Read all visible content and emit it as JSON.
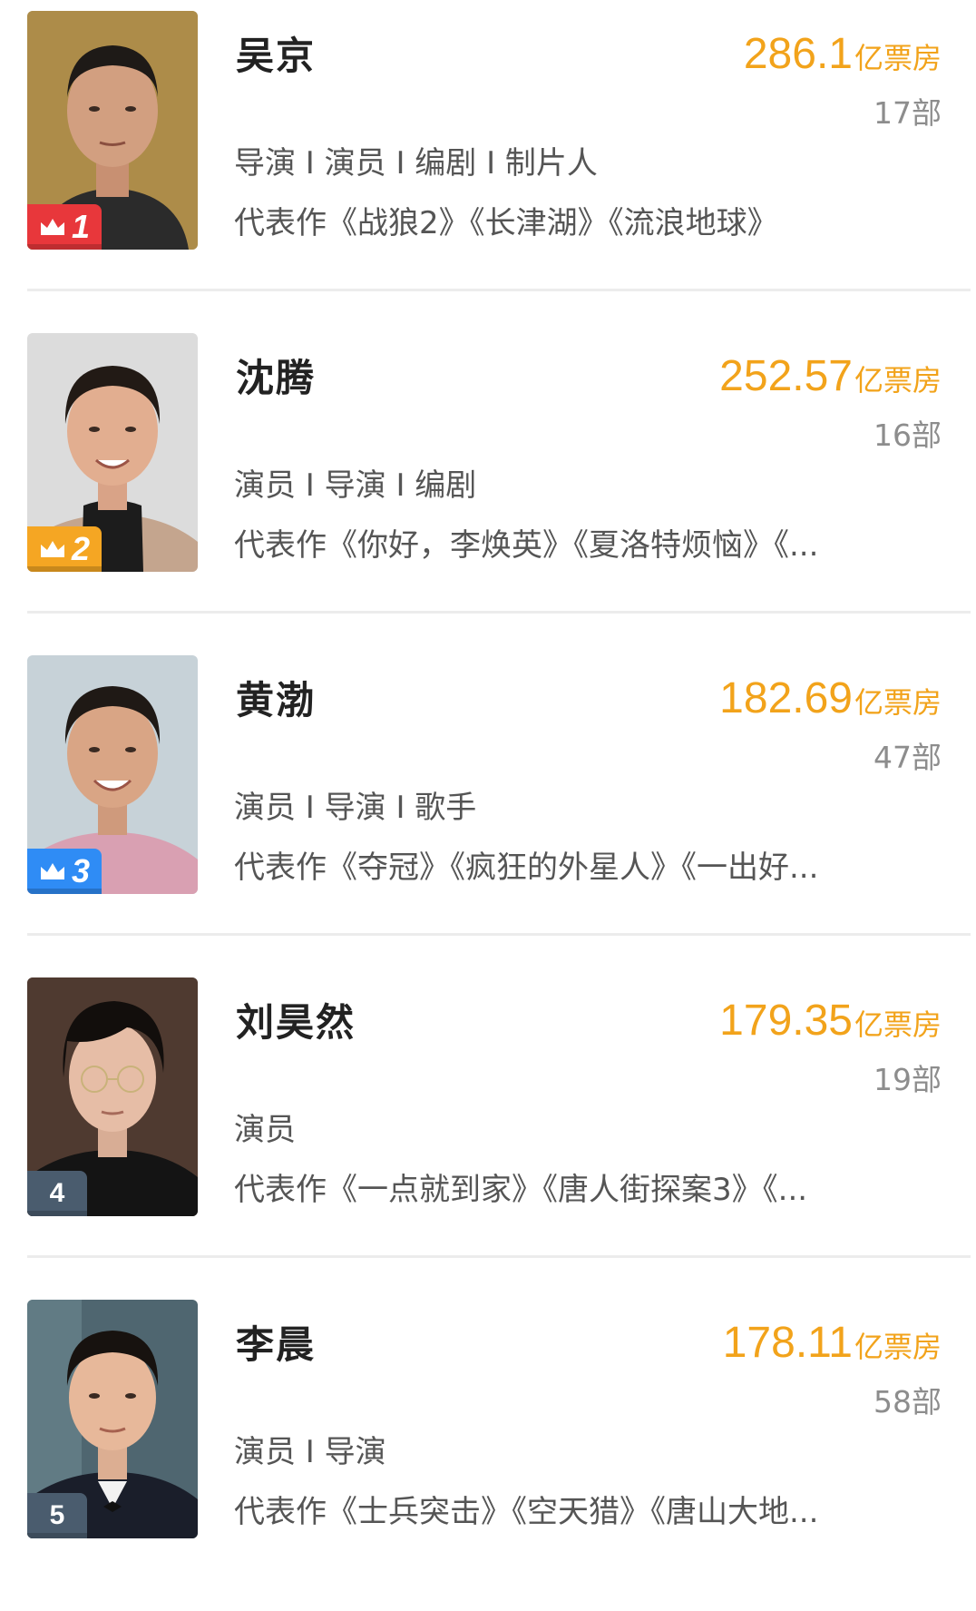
{
  "colors": {
    "boxoffice": "#f2a31b",
    "rank_1": "#e8373b",
    "rank_2": "#f5a623",
    "rank_3": "#2f8cf5",
    "rank_other": "#4a5c6e",
    "divider": "#ececec"
  },
  "rankings": [
    {
      "rank": "1",
      "name": "吴京",
      "boxoffice_value": "286.1",
      "boxoffice_unit": "亿票房",
      "film_count": "17部",
      "roles": "导演 I 演员 I 编剧 I 制片人",
      "works": "代表作《战狼2》《长津湖》《流浪地球》",
      "badge_icon": "crown-icon"
    },
    {
      "rank": "2",
      "name": "沈腾",
      "boxoffice_value": "252.57",
      "boxoffice_unit": "亿票房",
      "film_count": "16部",
      "roles": "演员 I 导演 I 编剧",
      "works": "代表作《你好，李焕英》《夏洛特烦恼》《...",
      "badge_icon": "crown-icon"
    },
    {
      "rank": "3",
      "name": "黄渤",
      "boxoffice_value": "182.69",
      "boxoffice_unit": "亿票房",
      "film_count": "47部",
      "roles": "演员 I 导演 I 歌手",
      "works": "代表作《夺冠》《疯狂的外星人》《一出好...",
      "badge_icon": "crown-icon"
    },
    {
      "rank": "4",
      "name": "刘昊然",
      "boxoffice_value": "179.35",
      "boxoffice_unit": "亿票房",
      "film_count": "19部",
      "roles": "演员",
      "works": "代表作《一点就到家》《唐人街探案3》《...",
      "badge_icon": ""
    },
    {
      "rank": "5",
      "name": "李晨",
      "boxoffice_value": "178.11",
      "boxoffice_unit": "亿票房",
      "film_count": "58部",
      "roles": "演员 I 导演",
      "works": "代表作《士兵突击》《空天猎》《唐山大地...",
      "badge_icon": ""
    }
  ]
}
